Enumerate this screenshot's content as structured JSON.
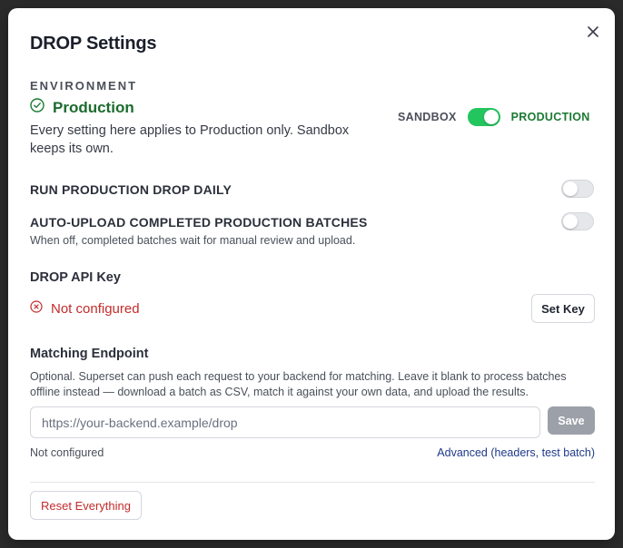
{
  "dialog": {
    "title": "DROP Settings",
    "close_icon": "close-icon"
  },
  "environment": {
    "label": "ENVIRONMENT",
    "status": "Production",
    "status_icon": "check-circle-icon",
    "description": "Every setting here applies to Production only. Sandbox keeps its own.",
    "toggle": {
      "left_label": "SANDBOX",
      "right_label": "PRODUCTION",
      "state": "production"
    }
  },
  "settings": {
    "run_daily": {
      "label": "RUN PRODUCTION DROP DAILY",
      "enabled": false
    },
    "auto_upload": {
      "label": "AUTO-UPLOAD COMPLETED PRODUCTION BATCHES",
      "help": "When off, completed batches wait for manual review and upload.",
      "enabled": false
    }
  },
  "api_key": {
    "heading": "DROP API Key",
    "status": "Not configured",
    "status_icon": "x-circle-icon",
    "button_label": "Set Key"
  },
  "endpoint": {
    "heading": "Matching Endpoint",
    "description": "Optional. Superset can push each request to your backend for matching. Leave it blank to process batches offline instead — download a batch as CSV, match it against your own data, and upload the results.",
    "input_value": "",
    "placeholder": "https://your-backend.example/drop",
    "save_label": "Save",
    "status": "Not configured",
    "advanced_link": "Advanced (headers, test batch)"
  },
  "footer": {
    "reset_label": "Reset Everything"
  },
  "colors": {
    "accent_green": "#22c55e",
    "production_text": "#1b7a32",
    "error_red": "#c42b2b",
    "link_blue": "#1e3a8a",
    "save_disabled": "#9ca0a8"
  }
}
